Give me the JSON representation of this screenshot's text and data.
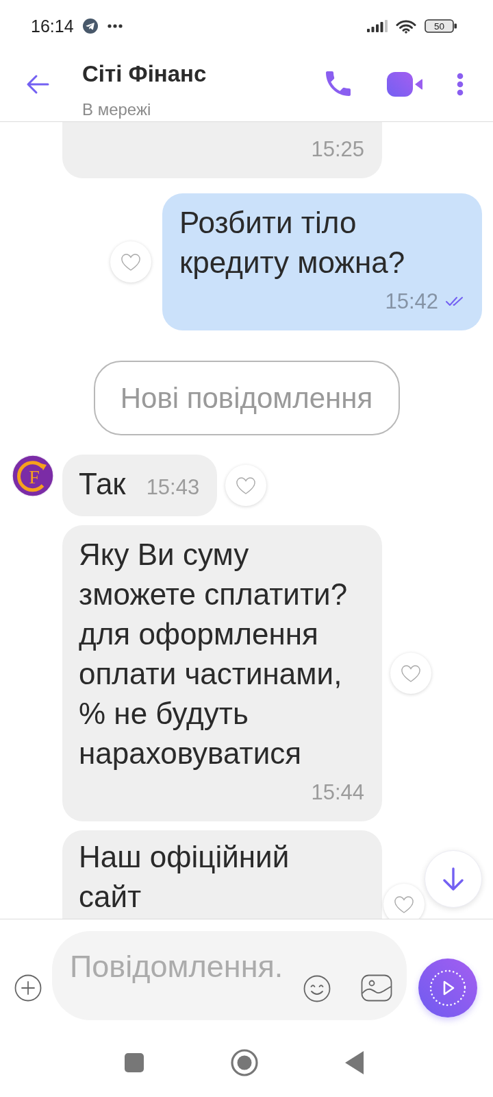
{
  "status_bar": {
    "time": "16:14",
    "battery": "50"
  },
  "header": {
    "title": "Сіті Фінанс",
    "subtitle": "В мережі"
  },
  "messages": [
    {
      "kind": "incoming",
      "time": "15:25",
      "reaction_button": false,
      "clipped_top": true
    },
    {
      "kind": "outgoing",
      "text": "Розбити тіло\nкредиту можна?",
      "time": "15:42",
      "read": true,
      "reaction_button": true
    },
    {
      "kind": "unread_divider",
      "label": "Нові повідомлення"
    },
    {
      "kind": "incoming",
      "text": "Так",
      "time": "15:43",
      "avatar": {
        "letter": "F"
      },
      "reaction_button": true
    },
    {
      "kind": "incoming",
      "text": "Яку Ви суму\nзможете сплатити?\nдля оформлення\nоплати частинами,\n% не будуть\nнараховуватися",
      "time": "15:44",
      "reaction_button": true
    },
    {
      "kind": "incoming",
      "text": "Наш офіційний\nсайт",
      "reaction_button": true,
      "clipped_bottom": true
    }
  ],
  "composer": {
    "placeholder": "Повідомлення."
  }
}
